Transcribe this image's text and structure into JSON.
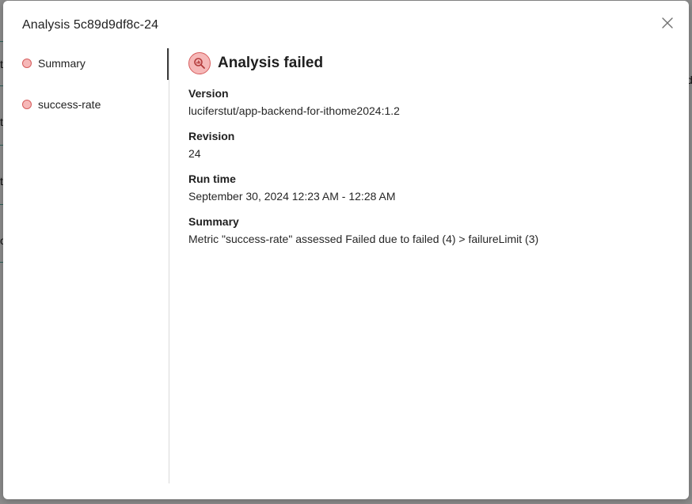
{
  "modal": {
    "title": "Analysis 5c89d9df8c-24"
  },
  "background": {
    "letters": [
      "t",
      "t",
      "t",
      "o"
    ],
    "edge_char": "d"
  },
  "sidebar": {
    "items": [
      {
        "label": "Summary",
        "status": "failed"
      },
      {
        "label": "success-rate",
        "status": "failed"
      }
    ]
  },
  "content": {
    "status_text": "Analysis failed",
    "fields": [
      {
        "label": "Version",
        "value": "luciferstut/app-backend-for-ithome2024:1.2"
      },
      {
        "label": "Revision",
        "value": "24"
      },
      {
        "label": "Run time",
        "value": "September 30, 2024 12:23 AM - 12:28 AM"
      },
      {
        "label": "Summary",
        "value": "Metric \"success-rate\" assessed Failed due to failed (4) > failureLimit (3)"
      }
    ]
  },
  "colors": {
    "failed_fill": "#f6b8b8",
    "failed_stroke": "#d65c5c",
    "overlay": "rgba(0,0,0,0.45)"
  },
  "icons": {
    "close": "close-icon",
    "status": "analysis-failed-icon",
    "dot": "status-dot-icon"
  }
}
